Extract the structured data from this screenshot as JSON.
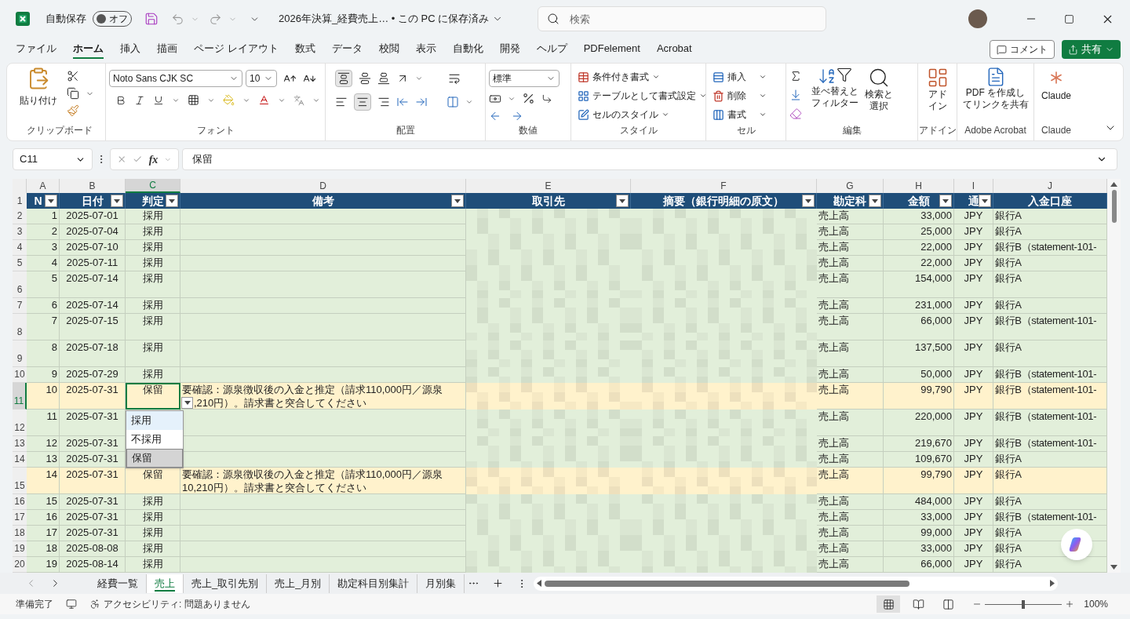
{
  "title_bar": {
    "autosave_label": "自動保存",
    "autosave_toggle": "オフ",
    "autosave_on": false,
    "file_title": "2026年決算_経費売上… • この PC に保存済み",
    "search_placeholder": "検索"
  },
  "menu_tabs": [
    {
      "label": "ファイル",
      "selected": false
    },
    {
      "label": "ホーム",
      "selected": true
    },
    {
      "label": "挿入",
      "selected": false
    },
    {
      "label": "描画",
      "selected": false
    },
    {
      "label": "ページ レイアウト",
      "selected": false
    },
    {
      "label": "数式",
      "selected": false
    },
    {
      "label": "データ",
      "selected": false
    },
    {
      "label": "校閲",
      "selected": false
    },
    {
      "label": "表示",
      "selected": false
    },
    {
      "label": "自動化",
      "selected": false
    },
    {
      "label": "開発",
      "selected": false
    },
    {
      "label": "ヘルプ",
      "selected": false
    },
    {
      "label": "PDFelement",
      "selected": false
    },
    {
      "label": "Acrobat",
      "selected": false
    }
  ],
  "comment_button": "コメント",
  "share_button": "共有",
  "ribbon": {
    "clipboard": {
      "paste": "貼り付け",
      "label": "クリップボード"
    },
    "font": {
      "family": "Noto Sans CJK SC",
      "size": "10",
      "label": "フォント"
    },
    "alignment": {
      "label": "配置"
    },
    "number": {
      "format": "標準",
      "label": "数値"
    },
    "styles": {
      "items": [
        "条件付き書式",
        "テーブルとして書式設定",
        "セルのスタイル"
      ],
      "label": "スタイル"
    },
    "cells": {
      "items": [
        "挿入",
        "削除",
        "書式"
      ],
      "label": "セル"
    },
    "editing": {
      "sort_lines": [
        "並べ替えと",
        "フィルター"
      ],
      "find_lines": [
        "検索と",
        "選択"
      ],
      "label": "編集"
    },
    "addins": {
      "button_lines": [
        "アド",
        "イン"
      ],
      "label": "アドイン"
    },
    "acrobat": {
      "button_lines": [
        "PDF を作成し",
        "てリンクを共有"
      ],
      "label": "Adobe Acrobat"
    },
    "claude": {
      "button": "Claude",
      "label": "Claude"
    }
  },
  "formula_bar": {
    "name_box": "C11",
    "function_symbol": "fx",
    "value": "保留"
  },
  "columns": [
    {
      "letter": "A",
      "selected": false
    },
    {
      "letter": "B",
      "selected": false
    },
    {
      "letter": "C",
      "selected": true
    },
    {
      "letter": "D",
      "selected": false
    },
    {
      "letter": "E",
      "selected": false
    },
    {
      "letter": "F",
      "selected": false
    },
    {
      "letter": "G",
      "selected": false
    },
    {
      "letter": "H",
      "selected": false
    },
    {
      "letter": "I",
      "selected": false
    },
    {
      "letter": "J",
      "selected": false
    }
  ],
  "header_row": {
    "row": "1",
    "cells": [
      "N",
      "日付",
      "判定",
      "備考",
      "取引先",
      "摘要（銀行明細の原文）",
      "勘定科",
      "金額",
      "通",
      "入金口座"
    ]
  },
  "rows": [
    {
      "row": "2",
      "no": "1",
      "date": "2025-07-01",
      "judgement": "採用",
      "note_lines": [],
      "account": "売上高",
      "amount": "33,000",
      "currency": "JPY",
      "bank": "銀行A",
      "color": "#e2efda",
      "selected": false
    },
    {
      "row": "3",
      "no": "2",
      "date": "2025-07-04",
      "judgement": "採用",
      "note_lines": [],
      "account": "売上高",
      "amount": "25,000",
      "currency": "JPY",
      "bank": "銀行A",
      "color": "#e2efda",
      "selected": false
    },
    {
      "row": "4",
      "no": "3",
      "date": "2025-07-10",
      "judgement": "採用",
      "note_lines": [],
      "account": "売上高",
      "amount": "22,000",
      "currency": "JPY",
      "bank": "銀行B（statement-101-",
      "color": "#e2efda",
      "selected": false
    },
    {
      "row": "5",
      "no": "4",
      "date": "2025-07-11",
      "judgement": "採用",
      "note_lines": [],
      "account": "売上高",
      "amount": "22,000",
      "currency": "JPY",
      "bank": "銀行A",
      "color": "#e2efda",
      "selected": false
    },
    {
      "row": "6",
      "no": "5",
      "date": "2025-07-14",
      "judgement": "採用",
      "note_lines": [],
      "account": "売上高",
      "amount": "154,000",
      "currency": "JPY",
      "bank": "銀行A",
      "color": "#e2efda",
      "selected": false
    },
    {
      "row": "7",
      "no": "6",
      "date": "2025-07-14",
      "judgement": "採用",
      "note_lines": [],
      "account": "売上高",
      "amount": "231,000",
      "currency": "JPY",
      "bank": "銀行A",
      "color": "#e2efda",
      "selected": false
    },
    {
      "row": "8",
      "no": "7",
      "date": "2025-07-15",
      "judgement": "採用",
      "note_lines": [],
      "account": "売上高",
      "amount": "66,000",
      "currency": "JPY",
      "bank": "銀行B（statement-101-",
      "color": "#e2efda",
      "selected": false
    },
    {
      "row": "9",
      "no": "8",
      "date": "2025-07-18",
      "judgement": "採用",
      "note_lines": [],
      "account": "売上高",
      "amount": "137,500",
      "currency": "JPY",
      "bank": "銀行A",
      "color": "#e2efda",
      "selected": false
    },
    {
      "row": "10",
      "no": "9",
      "date": "2025-07-29",
      "judgement": "採用",
      "note_lines": [],
      "account": "売上高",
      "amount": "50,000",
      "currency": "JPY",
      "bank": "銀行B（statement-101-",
      "color": "#e2efda",
      "selected": false
    },
    {
      "row": "11",
      "no": "10",
      "date": "2025-07-31",
      "judgement": "保留",
      "note_lines": [
        "要確認：源泉徴収後の入金と推定（請求110,000円／源泉",
        ",210円）。請求書と突合してください"
      ],
      "account": "売上高",
      "amount": "99,790",
      "currency": "JPY",
      "bank": "銀行B（statement-101-",
      "color": "#fff2cc",
      "selected": true
    },
    {
      "row": "12",
      "no": "11",
      "date": "2025-07-31",
      "note_lines": [],
      "account": "売上高",
      "amount": "220,000",
      "currency": "JPY",
      "bank": "銀行B（statement-101-",
      "color": "#e2efda",
      "selected": false
    },
    {
      "row": "13",
      "no": "12",
      "date": "2025-07-31",
      "note_lines": [],
      "account": "売上高",
      "amount": "219,670",
      "currency": "JPY",
      "bank": "銀行B（statement-101-",
      "color": "#e2efda",
      "selected": false
    },
    {
      "row": "14",
      "no": "13",
      "date": "2025-07-31",
      "note_lines": [],
      "account": "売上高",
      "amount": "109,670",
      "currency": "JPY",
      "bank": "銀行A",
      "color": "#e2efda",
      "selected": false
    },
    {
      "row": "15",
      "no": "14",
      "date": "2025-07-31",
      "judgement": "保留",
      "note_lines": [
        "要確認：源泉徴収後の入金と推定（請求110,000円／源泉",
        "10,210円）。請求書と突合してください"
      ],
      "account": "売上高",
      "amount": "99,790",
      "currency": "JPY",
      "bank": "銀行A",
      "color": "#fff2cc",
      "selected": false
    },
    {
      "row": "16",
      "no": "15",
      "date": "2025-07-31",
      "judgement": "採用",
      "note_lines": [],
      "account": "売上高",
      "amount": "484,000",
      "currency": "JPY",
      "bank": "銀行A",
      "color": "#e2efda",
      "selected": false
    },
    {
      "row": "17",
      "no": "16",
      "date": "2025-07-31",
      "judgement": "採用",
      "note_lines": [],
      "account": "売上高",
      "amount": "33,000",
      "currency": "JPY",
      "bank": "銀行B（statement-101-",
      "color": "#e2efda",
      "selected": false
    },
    {
      "row": "18",
      "no": "17",
      "date": "2025-07-31",
      "judgement": "採用",
      "note_lines": [],
      "account": "売上高",
      "amount": "99,000",
      "currency": "JPY",
      "bank": "銀行A",
      "color": "#e2efda",
      "selected": false
    },
    {
      "row": "19",
      "no": "18",
      "date": "2025-08-08",
      "judgement": "採用",
      "note_lines": [],
      "account": "売上高",
      "amount": "33,000",
      "currency": "JPY",
      "bank": "銀行A",
      "color": "#e2efda",
      "selected": false
    },
    {
      "row": "20",
      "no": "19",
      "date": "2025-08-14",
      "judgement": "採用",
      "note_lines": [],
      "account": "売上高",
      "amount": "66,000",
      "currency": "JPY",
      "bank": "銀行A",
      "color": "#e2efda",
      "selected": false
    }
  ],
  "dropdown": {
    "options": [
      {
        "label": "採用",
        "hovered": true,
        "selected": false
      },
      {
        "label": "不採用",
        "hovered": false,
        "selected": false
      },
      {
        "label": "保留",
        "hovered": false,
        "selected": true
      }
    ]
  },
  "sheet_tabs": [
    {
      "label": "経費一覧",
      "selected": false
    },
    {
      "label": "売上",
      "selected": true
    },
    {
      "label": "売上_取引先別",
      "selected": false
    },
    {
      "label": "売上_月別",
      "selected": false
    },
    {
      "label": "勘定科目別集計",
      "selected": false
    },
    {
      "label": "月別集",
      "selected": false
    }
  ],
  "status_bar": {
    "ready": "準備完了",
    "accessibility": "アクセシビリティ: 問題ありません",
    "views": [
      {
        "kind": "normal",
        "selected": true
      },
      {
        "kind": "page_layout",
        "selected": false
      },
      {
        "kind": "page_break",
        "selected": false
      }
    ],
    "zoom": {
      "level": 0.5
    },
    "zoom_text": "100%"
  }
}
